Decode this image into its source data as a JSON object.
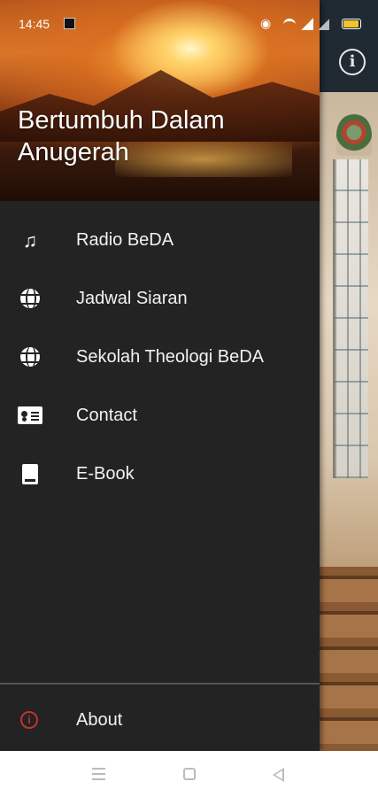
{
  "status_bar": {
    "time": "14:45"
  },
  "drawer": {
    "title": "Bertumbuh Dalam Anugerah",
    "items": [
      {
        "label": "Radio BeDA",
        "icon": "music-note-icon"
      },
      {
        "label": "Jadwal Siaran",
        "icon": "globe-icon"
      },
      {
        "label": "Sekolah Theologi BeDA",
        "icon": "globe-icon"
      },
      {
        "label": "Contact",
        "icon": "contact-card-icon"
      },
      {
        "label": "E-Book",
        "icon": "book-icon"
      }
    ],
    "footer": {
      "label": "About",
      "icon": "info-icon",
      "icon_color": "#c2332b"
    }
  },
  "colors": {
    "drawer_bg": "#232323",
    "header_accent": "#d9782c",
    "battery": "#f4c22b"
  },
  "background_app": {
    "toolbar_icon": "info-icon"
  },
  "navigation_bar": {
    "buttons": [
      "menu-icon",
      "home-icon",
      "back-icon"
    ]
  }
}
